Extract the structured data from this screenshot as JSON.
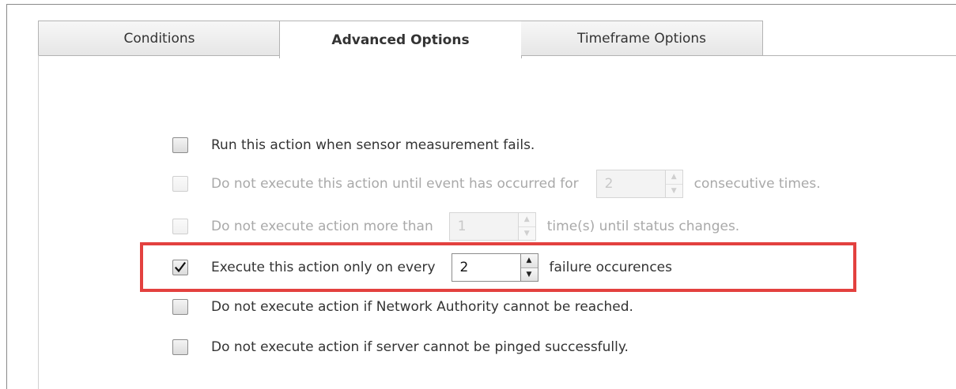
{
  "tabs": [
    {
      "label": "Conditions",
      "active": false
    },
    {
      "label": "Advanced Options",
      "active": true
    },
    {
      "label": "Timeframe Options",
      "active": false
    }
  ],
  "options": {
    "run_on_fail": {
      "label": "Run this action when sensor measurement fails.",
      "checked": false,
      "enabled": true
    },
    "consecutive": {
      "label_before": "Do not execute this action until event has occurred for",
      "value": "2",
      "label_after": "consecutive times.",
      "checked": false,
      "enabled": false
    },
    "max_times": {
      "label_before": "Do not execute action more than",
      "value": "1",
      "label_after": "time(s) until status changes.",
      "checked": false,
      "enabled": false
    },
    "every_failure": {
      "label_before": "Execute this action only on every",
      "value": "2",
      "label_after": "failure occurences",
      "checked": true,
      "enabled": true
    },
    "network_authority": {
      "label": "Do not execute action if Network Authority cannot be reached.",
      "checked": false,
      "enabled": true
    },
    "server_ping": {
      "label": "Do not execute action if server cannot be pinged successfully.",
      "checked": false,
      "enabled": true
    }
  },
  "highlight_color": "#e3413f",
  "icons": {
    "check": "checkmark-icon",
    "up": "arrow-up-icon",
    "down": "arrow-down-icon"
  }
}
